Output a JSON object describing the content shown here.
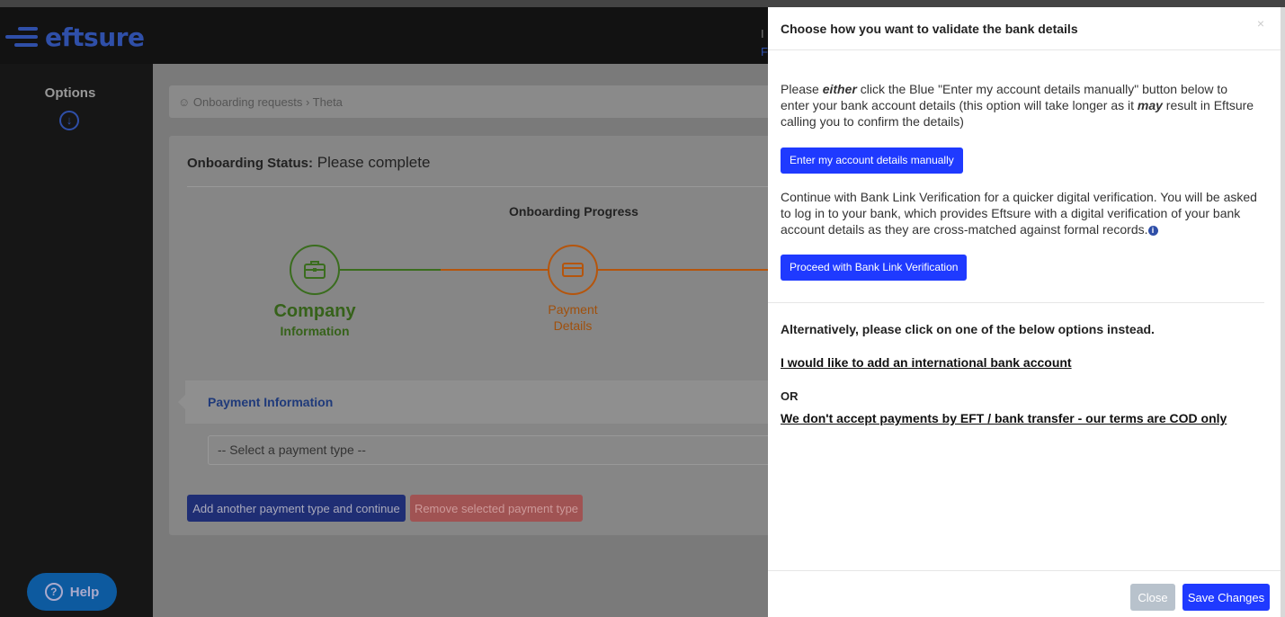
{
  "header": {
    "brand": "eftsure",
    "peek_top": "I",
    "peek_bottom": "F"
  },
  "sidebar": {
    "title": "Options",
    "toggle_icon": "arrow-down-circle-icon",
    "help_label": "Help"
  },
  "breadcrumb": {
    "items": [
      "Onboarding requests",
      "Theta"
    ]
  },
  "status": {
    "label": "Onboarding Status:",
    "value": "Please complete"
  },
  "progress": {
    "title": "Onboarding Progress",
    "steps": [
      {
        "title": "Company",
        "subtitle": "Information",
        "color": "#3a6d1e"
      },
      {
        "title": "Payment",
        "subtitle": "Details",
        "color": "#b5550c"
      }
    ]
  },
  "payment": {
    "section_label": "Payment Information",
    "select_placeholder": "-- Select a payment type --",
    "add_button": "Add another payment type and continue",
    "remove_button": "Remove selected payment type"
  },
  "modal": {
    "title": "Choose how you want to validate the bank details",
    "close_x": "×",
    "p1_pre": "Please ",
    "p1_em1": "either",
    "p1_mid": " click the Blue \"Enter my account details manually\" button below to enter your bank account details (this option will take longer as it ",
    "p1_em2": "may",
    "p1_post": " result in Eftsure calling you to confirm the details)",
    "manual_button": "Enter my account details manually",
    "p2": "Continue with Bank Link Verification for a quicker digital verification. You will be asked to log in to your bank, which provides Eftsure with a digital verification of your bank account details as they are cross-matched against formal records.",
    "info_icon_glyph": "i",
    "banklink_button": "Proceed with Bank Link Verification",
    "alternative_text": "Alternatively, please click on one of the below options instead.",
    "international_link": "I would like to add an international bank account",
    "or_text": "OR",
    "cod_link": "We don't accept payments by EFT / bank transfer - our terms are COD only",
    "close_button": "Close",
    "save_button": "Save Changes"
  }
}
